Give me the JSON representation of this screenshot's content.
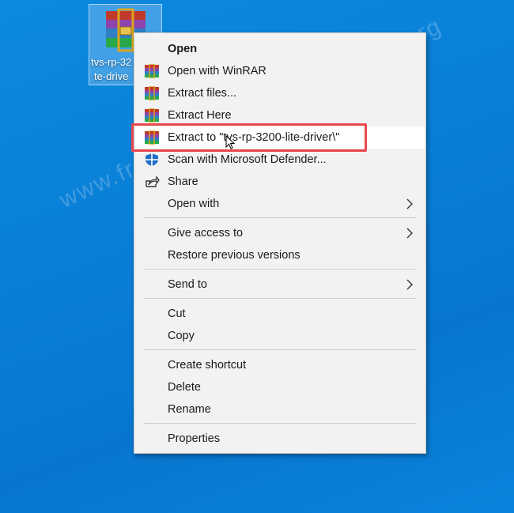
{
  "desktop": {
    "file_label_line1": "tvs-rp-32",
    "file_label_line2": "te-drive",
    "watermark": "www.freeprinterdriverdownload.org"
  },
  "menu": {
    "items": [
      {
        "label": "Open"
      },
      {
        "label": "Open with WinRAR"
      },
      {
        "label": "Extract files..."
      },
      {
        "label": "Extract Here"
      },
      {
        "label": "Extract to \"tvs-rp-3200-lite-driver\\\""
      },
      {
        "label": "Scan with Microsoft Defender..."
      },
      {
        "label": "Share"
      },
      {
        "label": "Open with"
      },
      {
        "label": "Give access to"
      },
      {
        "label": "Restore previous versions"
      },
      {
        "label": "Send to"
      },
      {
        "label": "Cut"
      },
      {
        "label": "Copy"
      },
      {
        "label": "Create shortcut"
      },
      {
        "label": "Delete"
      },
      {
        "label": "Rename"
      },
      {
        "label": "Properties"
      }
    ]
  },
  "colors": {
    "desktop_bg": "#0a7fd6",
    "menu_bg": "#f2f2f2",
    "highlight_border": "#e8474d"
  }
}
